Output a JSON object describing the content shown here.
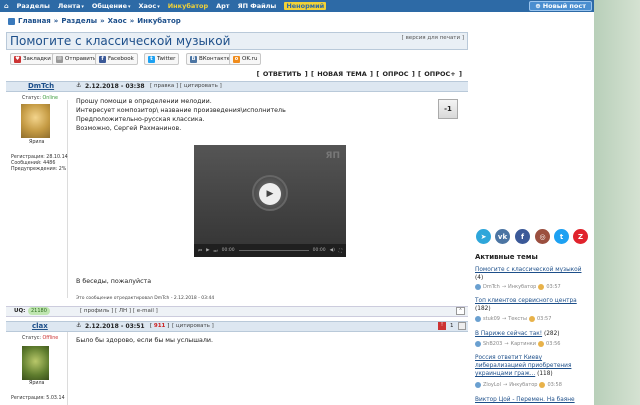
{
  "nav": {
    "items": [
      {
        "label": "Разделы",
        "chev": ""
      },
      {
        "label": "Лента",
        "chev": "▾"
      },
      {
        "label": "Общение",
        "chev": "▾"
      },
      {
        "label": "Хаос",
        "chev": "▾"
      },
      {
        "label": "Инкубатор",
        "chev": ""
      },
      {
        "label": "Арт",
        "chev": ""
      },
      {
        "label": "ЯП Файлы",
        "chev": ""
      },
      {
        "label": "Ненормий",
        "chev": ""
      }
    ],
    "new_post": "Новый пост"
  },
  "breadcrumb": [
    "Главная",
    "Разделы",
    "Хаос",
    "Инкубатор"
  ],
  "page_title": "Помогите с классической музыкой",
  "print_version": "[ версия для печати ]",
  "share": [
    "Закладки",
    "Отправить",
    "Facebook",
    "Twitter",
    "ВКонтакте",
    "OK.ru"
  ],
  "actions": "[ ОТВЕТИТЬ ] [ НОВАЯ ТЕМА ] [ ОПРОС ] [ ОПРОС+ ]",
  "post1": {
    "author": "DmTch",
    "date": "2.12.2018 - 03:38",
    "links": "[ правка ] [ цитировать ]",
    "status_label": "Статус:",
    "status": "Online",
    "avatar_caption": "Ярила",
    "reg": "Регистрация: 28.10.14",
    "msgs": "Сообщений: 4486",
    "warn": "Предупреждения: 2%",
    "body": [
      "Прошу помощи в определении мелодии.",
      "Интересует композитор\\ название произведения\\исполнитель",
      "Предположительно-русская классика.",
      "Возможно, Сергей Рахманинов."
    ],
    "vote": "-1",
    "footer_text": "В беседы, пожалуйста",
    "edited": "Это сообщение отредактировал DmTch - 2.12.2018 - 03:44",
    "uq_label": "UQ:",
    "uq_value": "21180",
    "profile_links": "[ профиль ] [ ЛН ] [ e-mail ]",
    "video_time_cur": "00:00",
    "video_time_end": "00:00"
  },
  "post2": {
    "author": "clax",
    "date": "2.12.2018 - 03:51",
    "num": "911",
    "links": "[ цитировать ]",
    "status_label": "Статус:",
    "status": "Offline",
    "avatar_caption": "Ярила",
    "reg": "Регистрация: 5.03.14",
    "body": "Было бы здорово, если бы мы услышали.",
    "count": "1"
  },
  "social": [
    {
      "icon": "telegram-icon",
      "glyph": "➤",
      "color": "#2ea6da"
    },
    {
      "icon": "vk-icon",
      "glyph": "vk",
      "color": "#4c75a3"
    },
    {
      "icon": "facebook-icon",
      "glyph": "f",
      "color": "#3b5998"
    },
    {
      "icon": "instagram-icon",
      "glyph": "◎",
      "color": "#9b4f3f"
    },
    {
      "icon": "twitter-icon",
      "glyph": "t",
      "color": "#1da1f2"
    },
    {
      "icon": "z-icon",
      "glyph": "Z",
      "color": "#e0232c"
    }
  ],
  "active_topics": {
    "header": "Активные темы",
    "items": [
      {
        "title": "Помогите с классической музыкой",
        "count": "(4)",
        "user": "DmTch",
        "section": "Инкубатор",
        "time": "03:57"
      },
      {
        "title": "Топ клиентов сервисного центра",
        "count": "(182)",
        "user": "stuk09",
        "section": "Тексты",
        "time": "03:57"
      },
      {
        "title": "В Париже сейчас так!",
        "count": "(282)",
        "user": "ShB203",
        "section": "Картинки",
        "time": "03:56"
      },
      {
        "title": "Россия ответит Киеву либерализацией приобретения украинцами граж...",
        "count": "(118)",
        "user": "ZloyLol",
        "section": "Инкубатор",
        "time": "03:58"
      },
      {
        "title": "Виктор Цой - Перемен. На баяне",
        "count": "",
        "user": "",
        "section": "",
        "time": ""
      }
    ]
  }
}
